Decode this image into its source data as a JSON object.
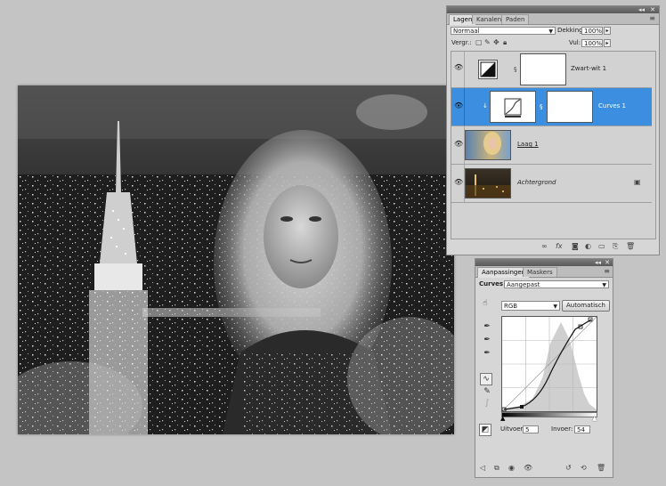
{
  "layers_panel": {
    "tabs": [
      "Lagen",
      "Kanalen",
      "Paden"
    ],
    "blend_mode": "Normaal",
    "opacity_label": "Dekking:",
    "opacity_value": "100%",
    "lock_label": "Vergr.:",
    "fill_label": "Vul:",
    "fill_value": "100%",
    "layers": [
      {
        "name": "Zwart-wit 1",
        "selected": false,
        "italic": false
      },
      {
        "name": "Curves 1",
        "selected": true,
        "italic": false
      },
      {
        "name": "Laag 1",
        "selected": false,
        "italic": false
      },
      {
        "name": "Achtergrond",
        "selected": false,
        "italic": true
      }
    ],
    "footer_icons": [
      "link-icon",
      "fx-icon",
      "mask-icon",
      "adjustment-icon",
      "folder-icon",
      "new-layer-icon",
      "trash-icon"
    ]
  },
  "adjustments_panel": {
    "tabs": [
      "Aanpassingen",
      "Maskers"
    ],
    "type_label": "Curves",
    "preset_value": "Aangepast",
    "channel_value": "RGB",
    "auto_button": "Automatisch",
    "output_label": "Uitvoer:",
    "output_value": "5",
    "input_label": "Invoer:",
    "input_value": "54",
    "footer_icons": [
      "back-icon",
      "clip-icon",
      "visibility-icon",
      "eye-icon",
      "previous-state-icon",
      "reset-icon",
      "trash-icon"
    ]
  },
  "colors": {
    "selection": "#3c8fe0",
    "panel_bg": "#d6d6d6",
    "workspace": "#c4c4c4"
  }
}
